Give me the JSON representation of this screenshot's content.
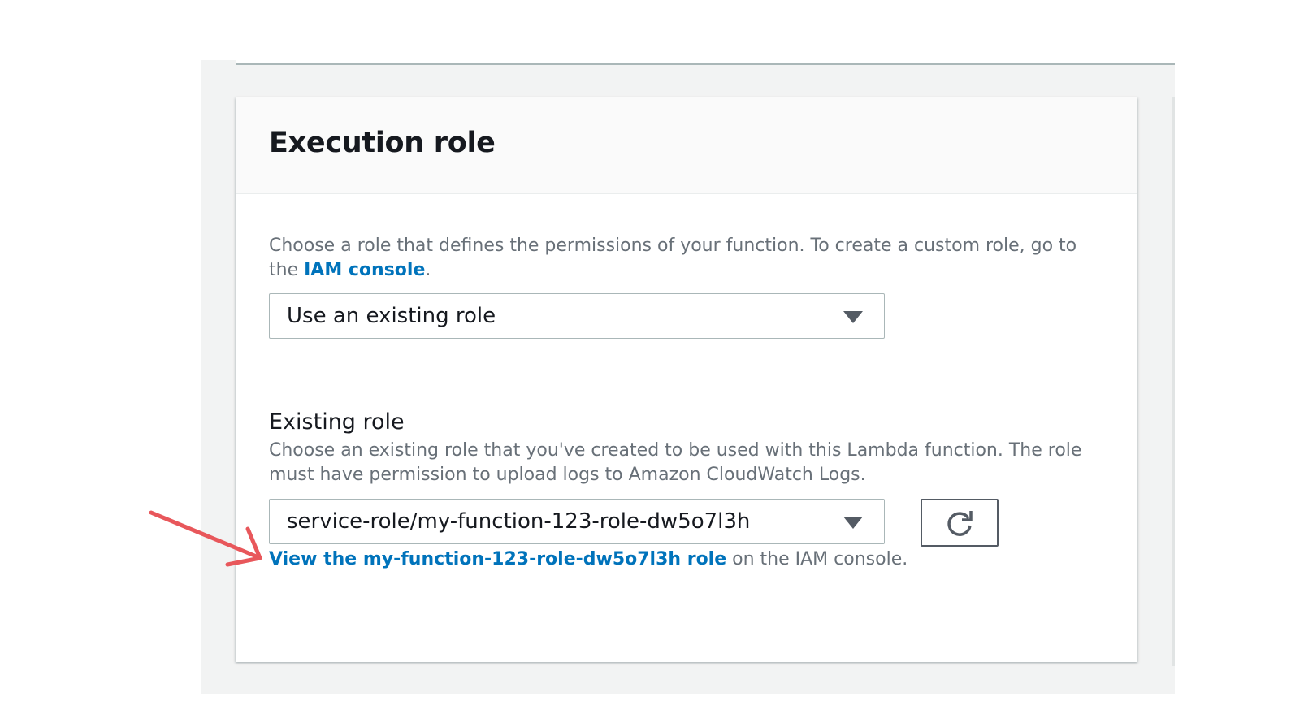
{
  "panel": {
    "title": "Execution role",
    "intro_before": "Choose a role that defines the permissions of your function. To create a custom role, go to the ",
    "intro_link": "IAM console",
    "intro_after": "."
  },
  "role_type_select": {
    "value": "Use an existing role"
  },
  "existing_role": {
    "label": "Existing role",
    "description": "Choose an existing role that you've created to be used with this Lambda function. The role must have permission to upload logs to Amazon CloudWatch Logs.",
    "select_value": "service-role/my-function-123-role-dw5o7l3h",
    "view_link": "View the my-function-123-role-dw5o7l3h role",
    "view_suffix": " on the IAM console."
  },
  "icons": {
    "dropdown": "caret-down-icon",
    "refresh": "refresh-icon",
    "annotation": "arrow-annotation"
  },
  "colors": {
    "link": "#0073bb",
    "annotation_arrow": "#e8575b",
    "page_gray": "#f2f3f3"
  }
}
